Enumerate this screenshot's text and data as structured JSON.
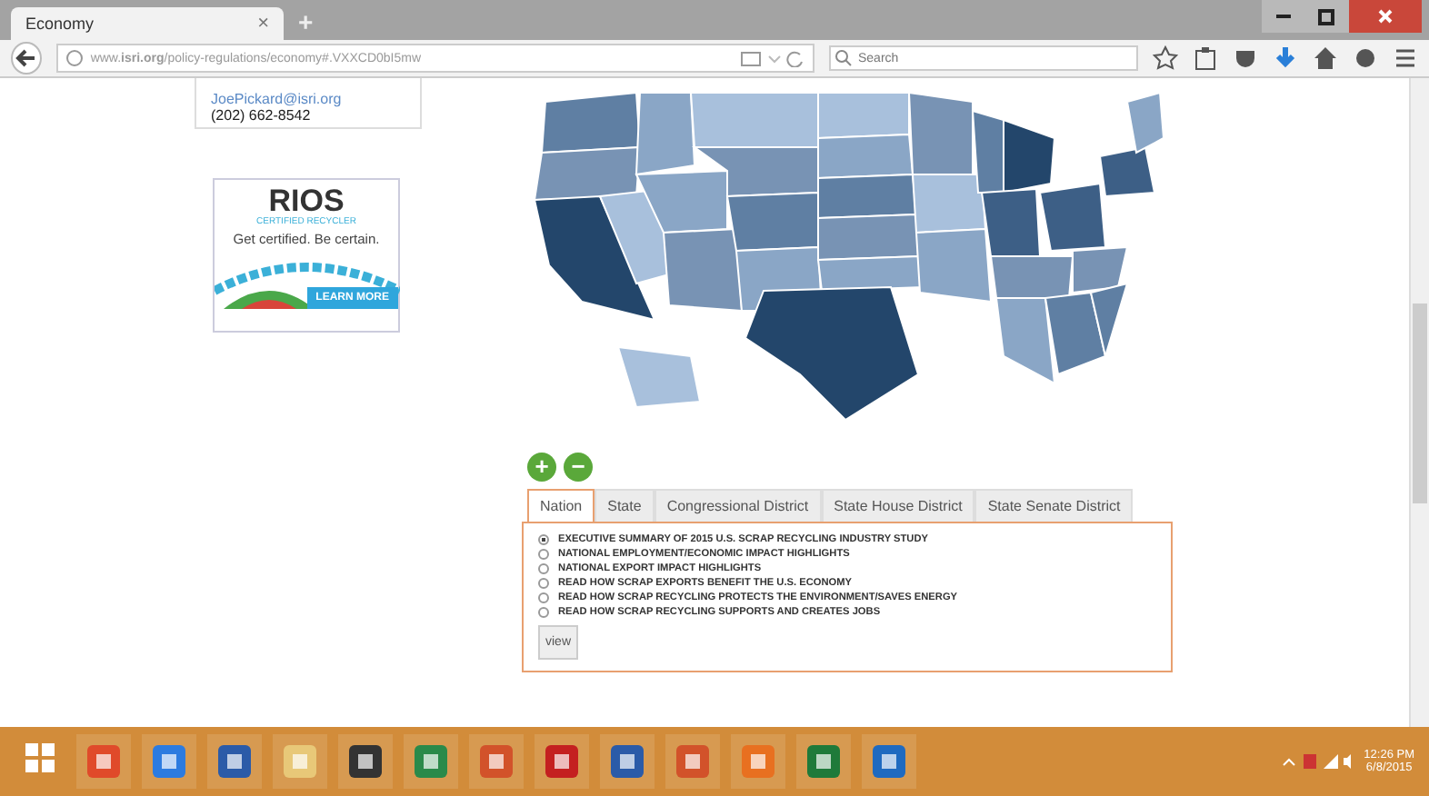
{
  "browser": {
    "tabs": [
      {
        "title": "Economy",
        "close": "×",
        "selected": true
      }
    ],
    "new_tab": "+",
    "url": "www.**isri.org**/policy-regulations/economy#.VXXCD0bI5mw",
    "search": {
      "placeholder": "Search"
    }
  },
  "contact": {
    "email": "JoePickard@isri.org",
    "phone": "(202) 662-8542"
  },
  "ad": {
    "logo": "RIOS",
    "tagline": "CERTIFIED RECYCLER",
    "headline": "Get certified. Be certain.",
    "button": "LEARN MORE"
  },
  "zoom": {
    "in": "+",
    "out": "−"
  },
  "panel": {
    "tabs": [
      {
        "label": "Nation",
        "selected": true
      },
      {
        "label": "State",
        "selected": false
      },
      {
        "label": "Congressional District",
        "selected": false
      },
      {
        "label": "State House District",
        "selected": false
      },
      {
        "label": "State Senate District",
        "selected": false
      }
    ],
    "options": [
      {
        "label": "EXECUTIVE SUMMARY OF 2015 U.S. SCRAP RECYCLING INDUSTRY STUDY",
        "selected": true
      },
      {
        "label": "NATIONAL EMPLOYMENT/ECONOMIC IMPACT HIGHLIGHTS",
        "selected": false
      },
      {
        "label": "NATIONAL EXPORT IMPACT HIGHLIGHTS",
        "selected": false
      },
      {
        "label": "READ HOW SCRAP EXPORTS BENEFIT THE U.S. ECONOMY",
        "selected": false
      },
      {
        "label": "READ HOW SCRAP RECYCLING PROTECTS THE ENVIRONMENT/SAVES ENERGY",
        "selected": false
      },
      {
        "label": "READ HOW SCRAP RECYCLING SUPPORTS AND CREATES JOBS",
        "selected": false
      }
    ],
    "button": "view"
  },
  "taskbar": {
    "time": "12:26 PM",
    "date": "6/8/2015"
  }
}
